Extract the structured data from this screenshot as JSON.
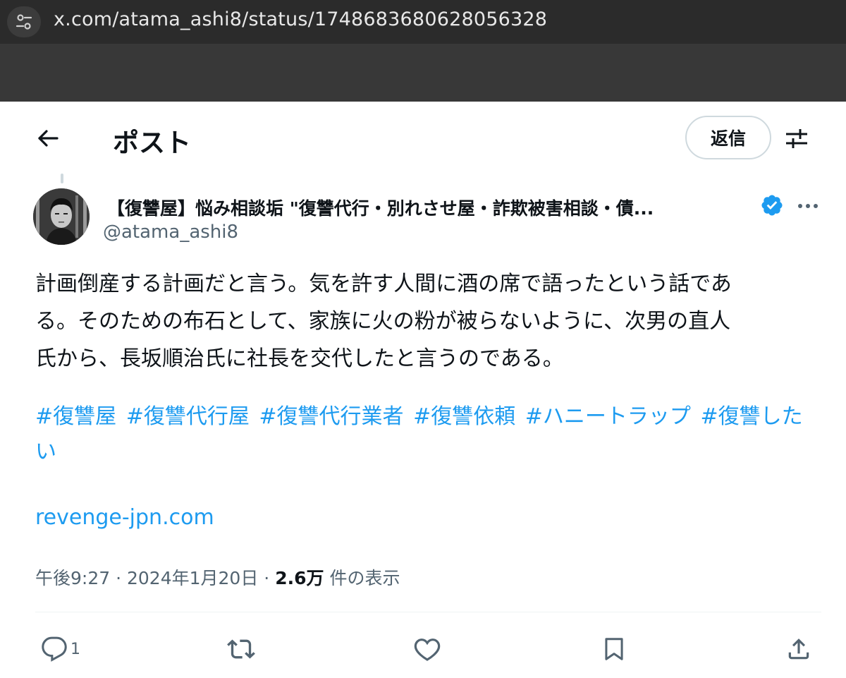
{
  "browser": {
    "url": "x.com/atama_ashi8/status/1748683680628056328"
  },
  "header": {
    "title": "ポスト",
    "reply_label": "返信"
  },
  "author": {
    "display_name": "【復讐屋】悩み相談垢 \"復讐代行・別れさせ屋・詐欺被害相談・債...",
    "handle": "@atama_ashi8"
  },
  "tweet": {
    "lines": [
      "計画倒産する計画だと言う。気を許す人間に酒の席で語ったという話であ",
      "る。そのための布石として、家族に火の粉が被らないように、次男の直人",
      "氏から、長坂順治氏に社長を交代したと言うのである。"
    ],
    "hashtags": [
      "#復讐屋",
      "#復讐代行屋",
      "#復讐代行業者",
      "#復讐依頼",
      "#ハニートラップ",
      "#復讐したい"
    ],
    "link": "revenge-jpn.com",
    "time": "午後9:27",
    "date": "2024年1月20日",
    "views_count": "2.6万",
    "views_label": "件の表示",
    "separator": "·"
  },
  "actions": {
    "reply_count": "1"
  },
  "colors": {
    "accent": "#1d9bf0",
    "verified": "#1d9bf0",
    "secondary_text": "#536471"
  }
}
